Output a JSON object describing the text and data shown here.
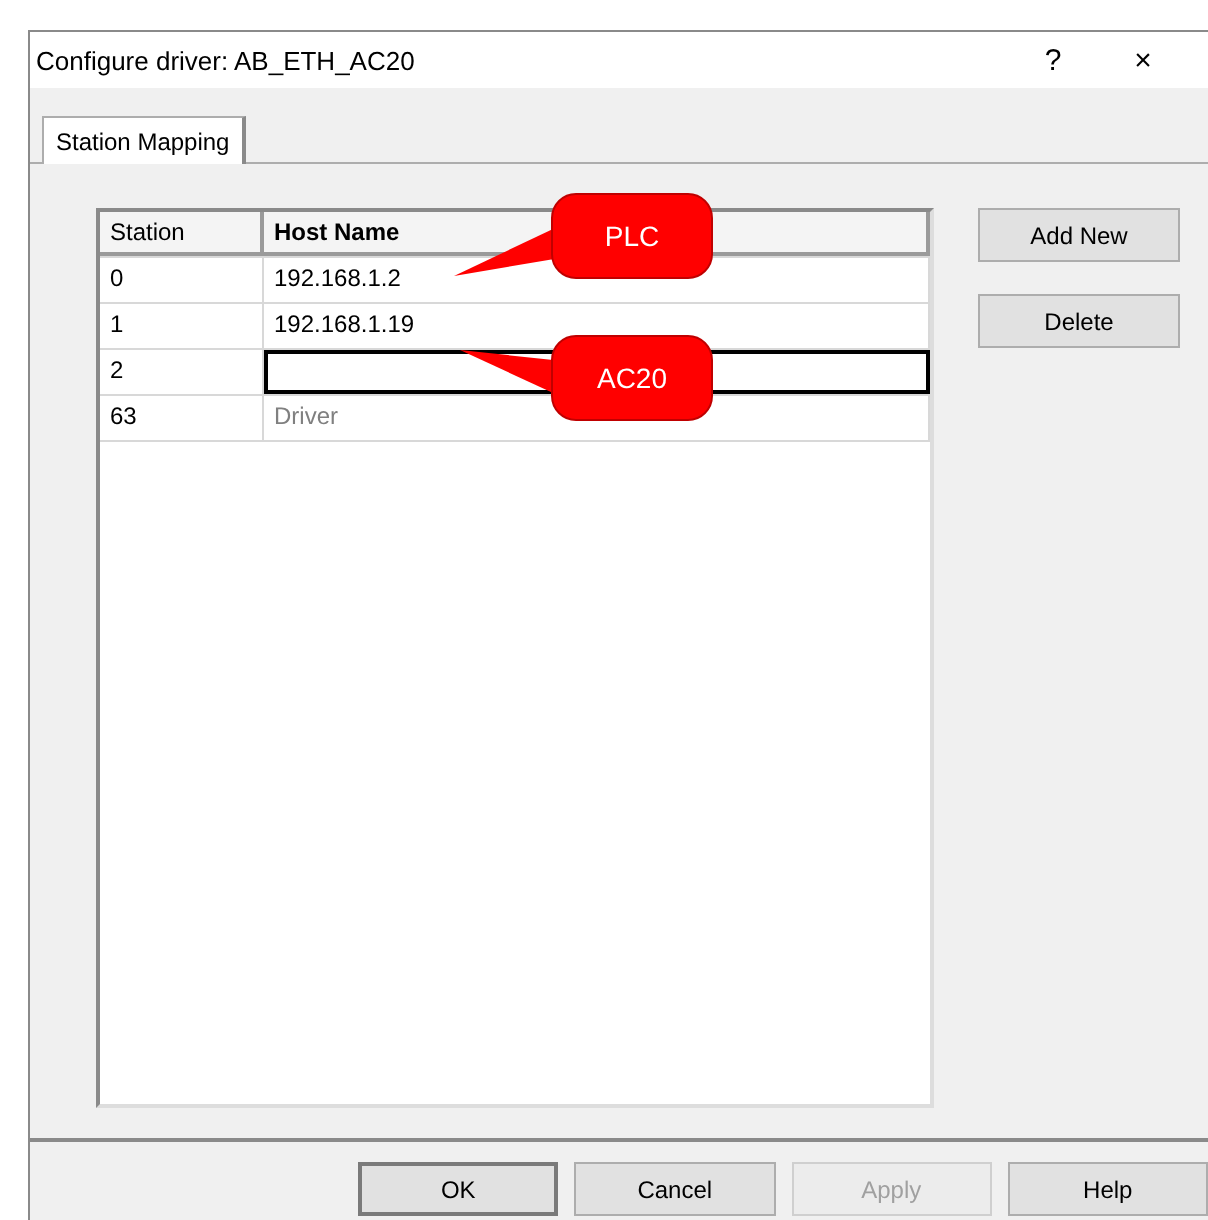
{
  "window": {
    "title": "Configure driver: AB_ETH_AC20",
    "title_buttons": [
      "?",
      "×"
    ]
  },
  "tabs": [
    {
      "label": "Station Mapping",
      "selected": true
    }
  ],
  "table": {
    "columns": [
      "Station",
      "Host Name"
    ],
    "rows": [
      {
        "station": "0",
        "host": "192.168.1.2",
        "editing": false,
        "disabled": false
      },
      {
        "station": "1",
        "host": "192.168.1.19",
        "editing": false,
        "disabled": false
      },
      {
        "station": "2",
        "host": "",
        "editing": true,
        "disabled": false
      },
      {
        "station": "63",
        "host": "Driver",
        "editing": false,
        "disabled": true
      }
    ]
  },
  "side_buttons": [
    {
      "label": "Add New"
    },
    {
      "label": "Delete"
    }
  ],
  "callouts": [
    {
      "text": "PLC"
    },
    {
      "text": "AC20"
    }
  ],
  "buttons": [
    {
      "label": "OK",
      "default": true,
      "disabled": false
    },
    {
      "label": "Cancel",
      "default": false,
      "disabled": false
    },
    {
      "label": "Apply",
      "default": false,
      "disabled": true
    },
    {
      "label": "Help",
      "default": false,
      "disabled": false
    }
  ]
}
